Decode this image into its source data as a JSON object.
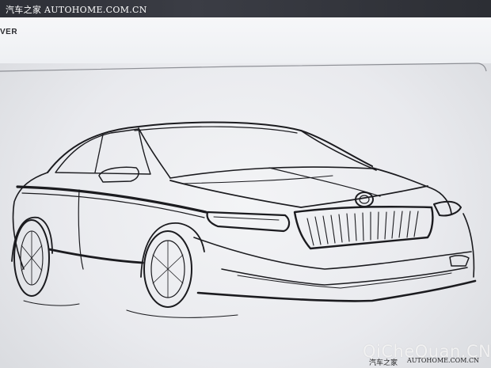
{
  "watermark_top": "汽车之家  AUTOHOME.COM.CN",
  "header_fragment": "VER",
  "watermark_bottom_large": "QiCheQuan.CN",
  "watermark_bottom_cn": "汽车之家",
  "watermark_bottom_url": "AUTOHOME.COM.CN",
  "colors": {
    "paper": "#eef0f3",
    "ink": "#1b1b1f",
    "top_strip": "#33353c"
  }
}
